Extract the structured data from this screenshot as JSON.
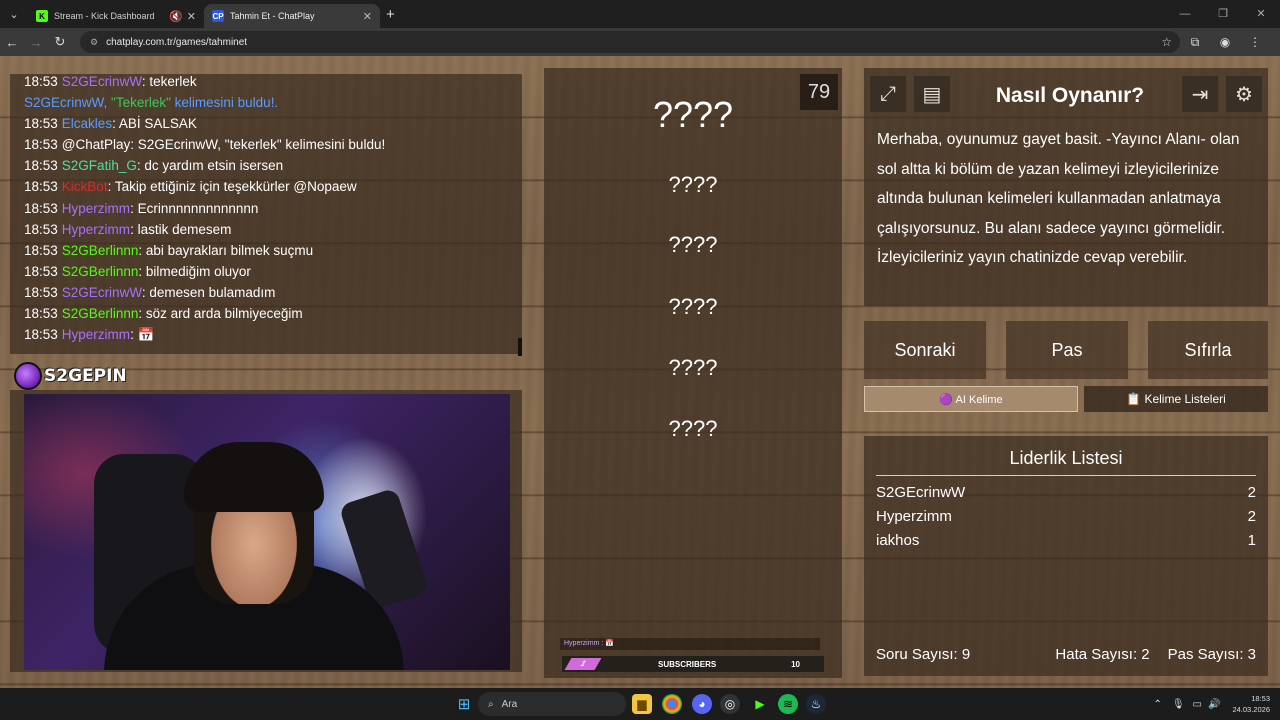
{
  "browser": {
    "tabs": [
      {
        "title": "Stream - Kick Dashboard",
        "icon": "kick-icon",
        "active": false
      },
      {
        "title": "Tahmin Et - ChatPlay",
        "icon": "chatplay-icon",
        "active": true
      }
    ],
    "url": "chatplay.com.tr/games/tahminet",
    "new_tab": "+",
    "window_controls": [
      "—",
      "❐",
      "✕"
    ]
  },
  "chat": {
    "messages": [
      {
        "time": "18:53",
        "user": "S2GEcrinwW",
        "text": ": tekerlek",
        "color": "#a970ff"
      },
      {
        "time": "",
        "user": "S2GEcrinwW, ",
        "text": "kelimesini buldu!.",
        "color": "#5b9bff",
        "highlight": "\"Tekerlek\" ",
        "highlight_color": "#3cc85a",
        "text_color": "#5b9bff"
      },
      {
        "time": "18:53",
        "user": "Elcakles",
        "text": ": ABİ SALSAK",
        "color": "#5b9bff"
      },
      {
        "time": "18:53",
        "user": "@ChatPlay",
        "text": ": S2GEcrinwW, \"tekerlek\" kelimesini buldu!",
        "color": "#ffffff"
      },
      {
        "time": "18:53",
        "user": "S2GFatih_G",
        "text": ": dc yardım etsin isersen",
        "color": "#4fe0a0"
      },
      {
        "time": "18:53",
        "user": "KickBot",
        "text": ": Takip ettiğiniz için teşekkürler @Nopaew",
        "color": "#d62c2c"
      },
      {
        "time": "18:53",
        "user": "Hyperzimm",
        "text": ": Ecrinnnnnnnnnnnnn",
        "color": "#a970ff"
      },
      {
        "time": "18:53",
        "user": "Hyperzimm",
        "text": ": lastik demesem",
        "color": "#a970ff"
      },
      {
        "time": "18:53",
        "user": "S2GBerlinnn",
        "text": ": abi bayrakları bilmek suçmu",
        "color": "#53fc18"
      },
      {
        "time": "18:53",
        "user": "S2GBerlinnn",
        "text": ": bilmediğim oluyor",
        "color": "#53fc18"
      },
      {
        "time": "18:53",
        "user": "S2GEcrinwW",
        "text": ": demesen bulamadım",
        "color": "#a970ff"
      },
      {
        "time": "18:53",
        "user": "S2GBerlinnn",
        "text": ": söz ard arda bilmiyeceğim",
        "color": "#53fc18"
      },
      {
        "time": "18:53",
        "user": "Hyperzimm",
        "text": ": 📅",
        "color": "#a970ff"
      }
    ]
  },
  "stream": {
    "logo_text": "S2GEPIN"
  },
  "game": {
    "counter": "79",
    "words": [
      "????",
      "????",
      "????",
      "????",
      "????",
      "????"
    ],
    "overlay_chat": "Hyperzimm : 📅",
    "sub_bar": {
      "chip": "1",
      "label": "SUBSCRIBERS",
      "value": "10"
    }
  },
  "info": {
    "title": "Nasıl Oynanır?",
    "description": "Merhaba, oyunumuz gayet basit. -Yayıncı Alanı- olan sol altta ki bölüm de yazan kelimeyi izleyicilerinize altında bulunan kelimeleri kullanmadan anlatmaya çalışıyorsunuz. Bu alanı sadece yayıncı görmelidir. İzleyicileriniz yayın chatinizde cevap verebilir.",
    "icons": [
      "fullscreen-icon",
      "book-icon",
      "exit-icon",
      "gear-icon"
    ]
  },
  "controls": {
    "next": "Sonraki",
    "pass": "Pas",
    "reset": "Sıfırla",
    "ai_word": "🟣 AI Kelime",
    "word_lists": "📋 Kelime Listeleri"
  },
  "leaderboard": {
    "title": "Liderlik Listesi",
    "rows": [
      {
        "name": "S2GEcrinwW",
        "score": "2"
      },
      {
        "name": "Hyperzimm",
        "score": "2"
      },
      {
        "name": "iakhos",
        "score": "1"
      }
    ],
    "stats": {
      "questions": "Soru Sayısı: 9",
      "errors": "Hata Sayısı: 2",
      "passes": "Pas Sayısı: 3"
    }
  },
  "taskbar": {
    "search": "Ara",
    "time": "18:53",
    "date": "24.03.2026"
  },
  "colors": {
    "page_bg": "#7c6249",
    "panel": "#3a2c20",
    "kick_green": "#53fc18",
    "accent_purple": "#d16bdb"
  }
}
